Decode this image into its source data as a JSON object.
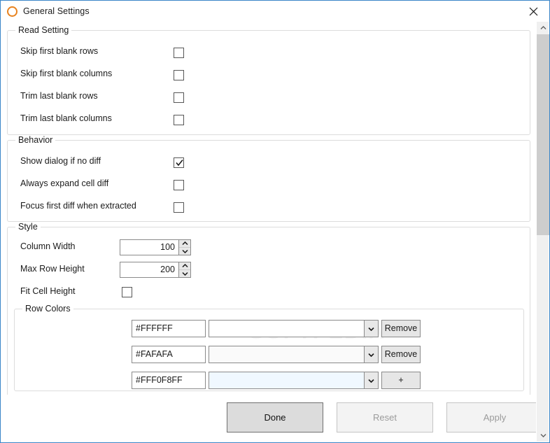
{
  "window": {
    "title": "General Settings",
    "icon": "circle-ring-icon",
    "icon_color": "#E8821E",
    "close_icon": "close-icon",
    "border_color": "#3B86C8"
  },
  "groups": {
    "read_setting": {
      "label": "Read Setting",
      "options": [
        {
          "label": "Skip first blank rows",
          "checked": false
        },
        {
          "label": "Skip first blank columns",
          "checked": false
        },
        {
          "label": "Trim last blank rows",
          "checked": false
        },
        {
          "label": "Trim last blank columns",
          "checked": false
        }
      ]
    },
    "behavior": {
      "label": "Behavior",
      "options": [
        {
          "label": "Show dialog if no diff",
          "checked": true
        },
        {
          "label": "Always expand cell diff",
          "checked": false
        },
        {
          "label": "Focus first diff when extracted",
          "checked": false
        }
      ]
    },
    "style": {
      "label": "Style",
      "column_width": {
        "label": "Column Width",
        "value": "100"
      },
      "max_row_height": {
        "label": "Max Row Height",
        "value": "200"
      },
      "fit_cell_height": {
        "label": "Fit Cell Height",
        "checked": false
      },
      "row_colors": {
        "label": "Row Colors",
        "rows": [
          {
            "hex": "#FFFFFF",
            "swatch": "#FFFFFF",
            "button": "Remove"
          },
          {
            "hex": "#FAFAFA",
            "swatch": "#FAFAFA",
            "button": "Remove"
          },
          {
            "hex": "#FFF0F8FF",
            "swatch": "#F0F8FF",
            "button": "+"
          }
        ]
      }
    }
  },
  "footer": {
    "done": "Done",
    "reset": "Reset",
    "apply": "Apply"
  },
  "watermark": {
    "text": "SOFTPEDIA",
    "mark": "®"
  }
}
